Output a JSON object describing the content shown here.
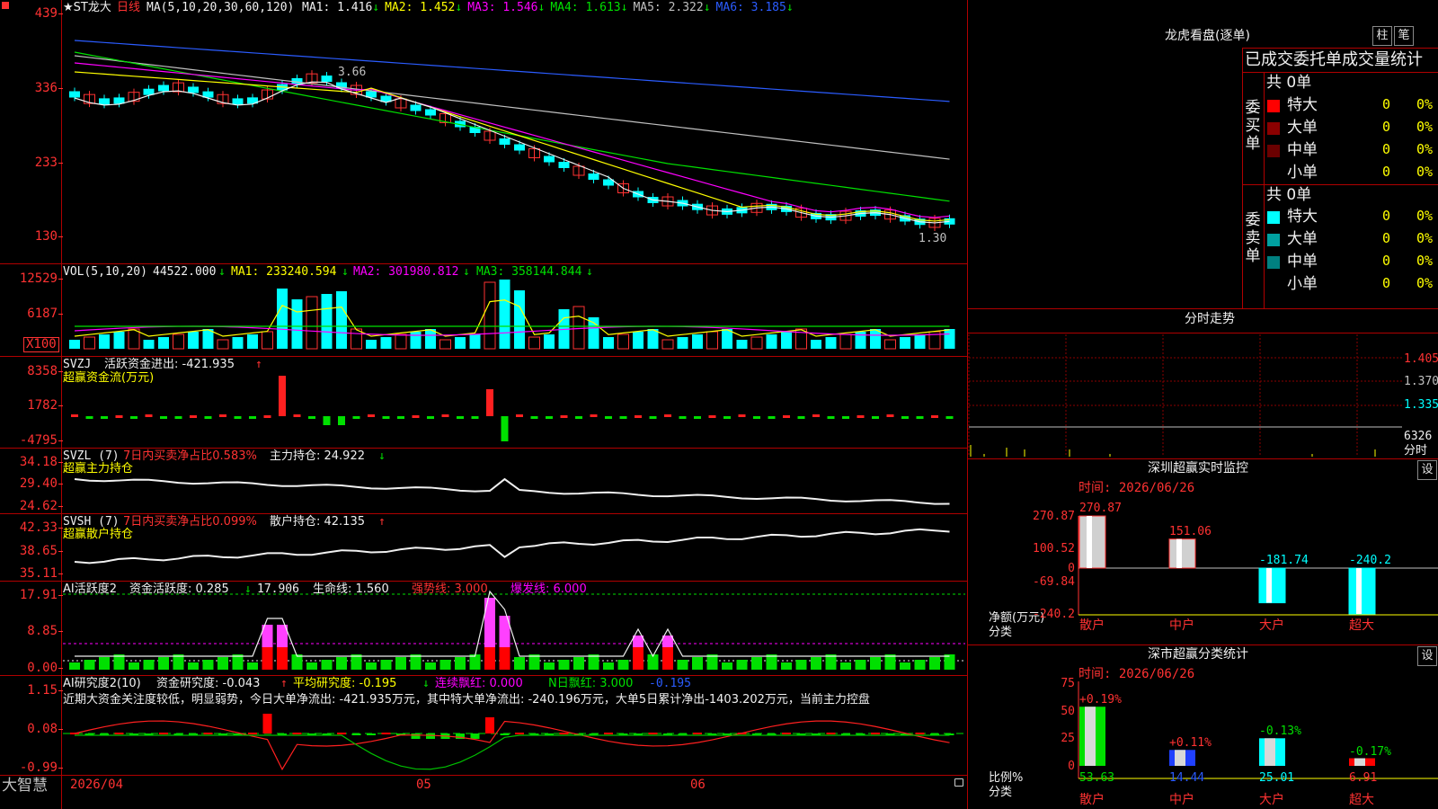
{
  "stock": {
    "name_star": "★ST龙大",
    "period": "日线",
    "ma_params": "MA(5,10,20,30,60,120)",
    "ma_values": [
      {
        "label": "MA1:",
        "value": "1.416",
        "arrow": "↓",
        "color": "#f0f0f0"
      },
      {
        "label": "MA2:",
        "value": "1.452",
        "arrow": "↓",
        "color": "#ffff00"
      },
      {
        "label": "MA3:",
        "value": "1.546",
        "arrow": "↓",
        "color": "#ff00ff"
      },
      {
        "label": "MA4:",
        "value": "1.613",
        "arrow": "↓",
        "color": "#00e000"
      },
      {
        "label": "MA5:",
        "value": "2.322",
        "arrow": "↓",
        "color": "#c0c0c0"
      },
      {
        "label": "MA6:",
        "value": "3.185",
        "arrow": "↓",
        "color": "#2b5cff"
      }
    ],
    "high_label": "3.66",
    "low_label": "1.30",
    "price_ticks": [
      "439",
      "336",
      "233",
      "130"
    ]
  },
  "vol": {
    "title": "VOL(5,10,20)",
    "value": "44522.000",
    "arrow": "↓",
    "ma1": "MA1: 233240.594",
    "ma1_arrow": "↓",
    "ma2": "MA2: 301980.812",
    "ma2_arrow": "↓",
    "ma3": "MA3: 358144.844",
    "ma3_arrow": "↓",
    "ticks": [
      "12529",
      "6187"
    ],
    "unit": "X100"
  },
  "svzj": {
    "title": "SVZJ",
    "label": "活跃资金进出: -421.935",
    "arrow": "↑",
    "sub": "超赢资金流(万元)",
    "ticks": [
      "8358",
      "1782",
      "-4795"
    ]
  },
  "svzl": {
    "title": "SVZL (7)",
    "pct": "7日内买卖净占比0.583%",
    "hold": "主力持仓: 24.922",
    "arrow": "↓",
    "sub": "超赢主力持仓",
    "ticks": [
      "34.18",
      "29.40",
      "24.62"
    ]
  },
  "svsh": {
    "title": "SVSH (7)",
    "pct": "7日内买卖净占比0.099%",
    "hold": "散户持仓: 42.135",
    "arrow": "↑",
    "sub": "超赢散户持仓",
    "ticks": [
      "42.33",
      "38.65",
      "35.11"
    ]
  },
  "ai1": {
    "title": "AI活跃度2",
    "a": "资金活跃度: 0.285",
    "a_arrow": "↓",
    "b": "17.906",
    "c": "生命线: 1.560",
    "d": "强势线: 3.000",
    "e": "爆发线: 6.000",
    "ticks": [
      "17.91",
      "8.85",
      "0.00"
    ]
  },
  "ai2": {
    "title": "AI研究度2(10)",
    "a": "资金研究度: -0.043",
    "a_arrow": "↑",
    "b": "平均研究度: -0.195",
    "b_arrow": "↓",
    "c": "连续飘红: 0.000",
    "d": "N日飘红: 3.000",
    "e": "-0.195",
    "note": "近期大资金关注度较低，明显弱势，今日大单净流出: -421.935万元，其中特大单净流出: -240.196万元，大单5日累计净出-1403.202万元，当前主力控盘",
    "ticks": [
      "1.15",
      "0.08",
      "-0.99"
    ]
  },
  "xaxis": {
    "brand": "大智慧",
    "d1": "2026/04",
    "d2": "05",
    "d3": "06"
  },
  "dragon": {
    "title": "龙虎看盘(逐单)",
    "btn1": "柱",
    "btn2": "笔",
    "header": "已成交委托单成交量统计",
    "buy": {
      "side": "委买单",
      "total": "共 0单",
      "rows": [
        {
          "name": "特大",
          "v": "0",
          "p": "0%",
          "color": "#ff0000"
        },
        {
          "name": "大单",
          "v": "0",
          "p": "0%",
          "color": "#8b0000"
        },
        {
          "name": "中单",
          "v": "0",
          "p": "0%",
          "color": "#6a0000"
        },
        {
          "name": "小单",
          "v": "0",
          "p": "0%",
          "color": "#000000"
        }
      ]
    },
    "sell": {
      "side": "委卖单",
      "total": "共 0单",
      "rows": [
        {
          "name": "特大",
          "v": "0",
          "p": "0%",
          "color": "#00ffff"
        },
        {
          "name": "大单",
          "v": "0",
          "p": "0%",
          "color": "#00a0a0"
        },
        {
          "name": "中单",
          "v": "0",
          "p": "0%",
          "color": "#008080"
        },
        {
          "name": "小单",
          "v": "0",
          "p": "0%",
          "color": "#000000"
        }
      ]
    }
  },
  "intraday": {
    "title": "分时走势",
    "ticks": [
      "1.405",
      "1.370",
      "1.335"
    ],
    "vol": "6326",
    "vol_unit": "分时"
  },
  "monitor": {
    "title": "深圳超赢实时监控",
    "btn": "设",
    "time": "时间: 2026/06/26",
    "ylabel": "净额(万元)",
    "xlabel": "分类",
    "ticks": [
      "270.87",
      "100.52",
      "0",
      "-69.84",
      "-240.2"
    ],
    "bars": [
      {
        "cat": "散户",
        "v": 270.87,
        "label": "270.87"
      },
      {
        "cat": "中户",
        "v": 151.06,
        "label": "151.06"
      },
      {
        "cat": "大户",
        "v": -181.74,
        "label": "-181.74"
      },
      {
        "cat": "超大",
        "v": -240.2,
        "label": "-240.2"
      }
    ]
  },
  "classify": {
    "title": "深市超赢分类统计",
    "btn": "设",
    "time": "时间: 2026/06/26",
    "ylabel": "比例%",
    "xlabel": "分类",
    "ticks": [
      "75",
      "50",
      "25",
      "0"
    ],
    "bars": [
      {
        "cat": "散户",
        "v": 53.63,
        "chg": "+0.19%",
        "val": "53.63"
      },
      {
        "cat": "中户",
        "v": 14.44,
        "chg": "+0.11%",
        "val": "14.44"
      },
      {
        "cat": "大户",
        "v": 25.01,
        "chg": "-0.13%",
        "val": "25.01"
      },
      {
        "cat": "超大",
        "v": 6.91,
        "chg": "-0.17%",
        "val": "6.91"
      }
    ]
  }
}
